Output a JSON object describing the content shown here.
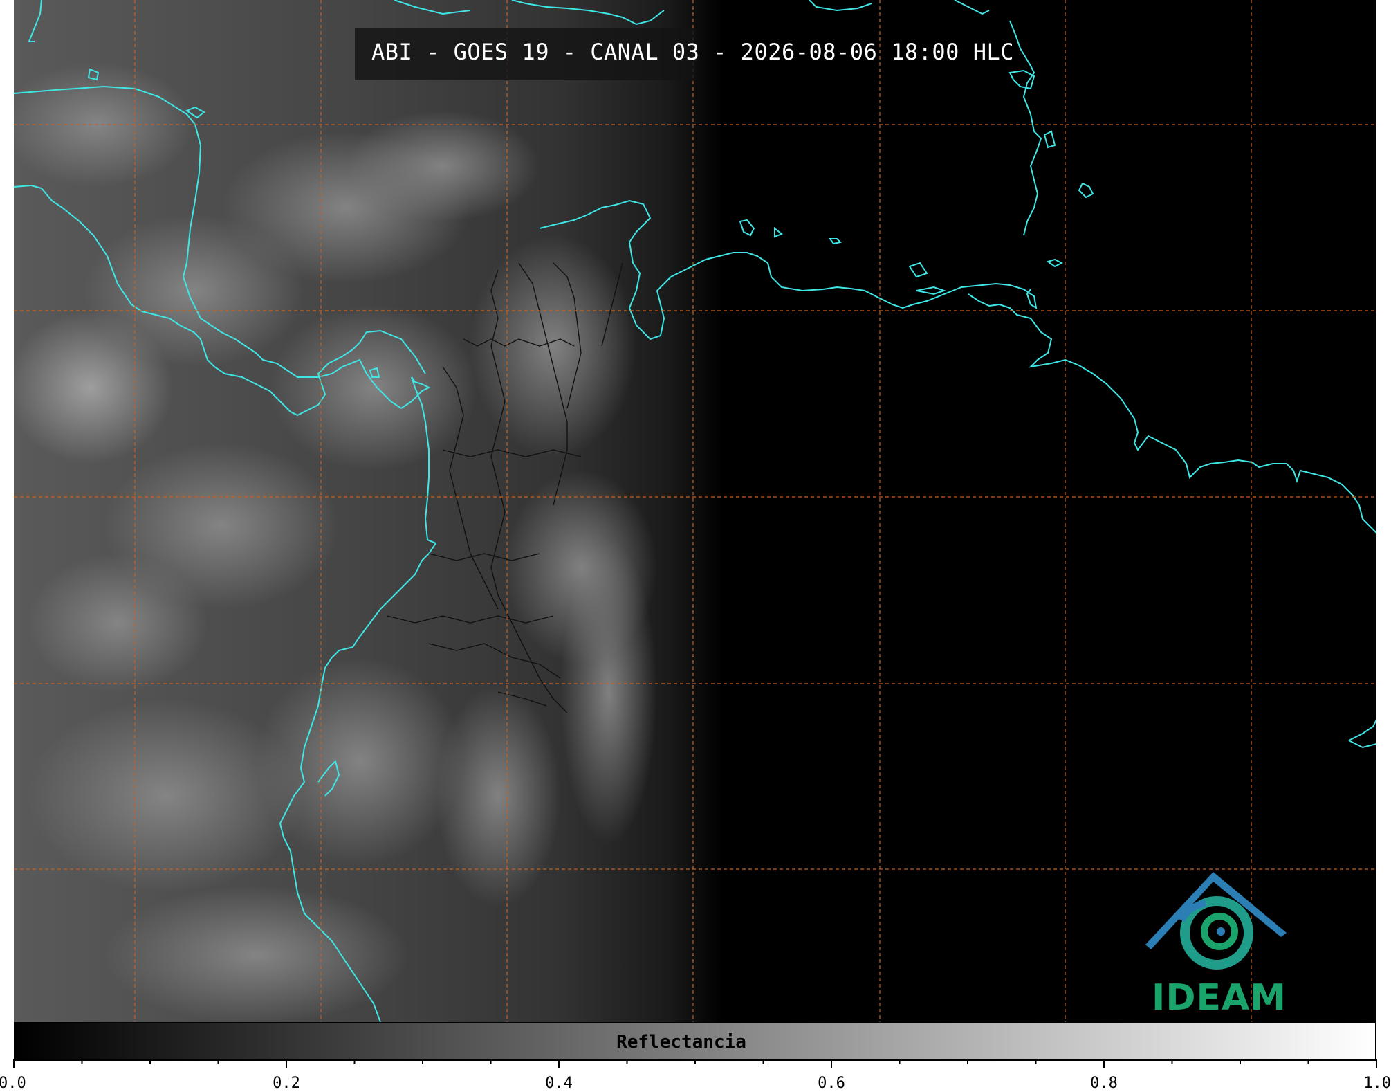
{
  "title": "ABI - GOES 19 - CANAL 03 - 2026-08-06 18:00 HLC",
  "colorbar": {
    "label": "Reflectancia",
    "min": 0.0,
    "max": 1.0,
    "ticks": [
      "0.0",
      "0.2",
      "0.4",
      "0.6",
      "0.8",
      "1.0"
    ],
    "minor_tick_step": 0.05
  },
  "logo": {
    "text": "IDEAM"
  },
  "colors": {
    "coastline": "#3fe6e6",
    "gridline": "#c8611e",
    "borders": "#111111",
    "logo_green": "#1aa36a",
    "logo_blue": "#2b7fb4"
  }
}
